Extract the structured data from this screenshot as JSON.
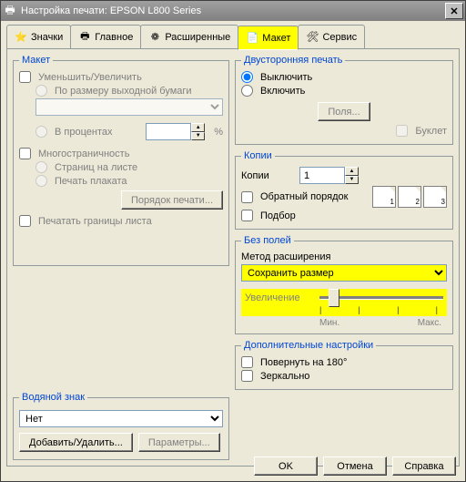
{
  "title": "Настройка печати: EPSON L800 Series",
  "tabs": {
    "icons": "Значки",
    "main": "Главное",
    "ext": "Расширенные",
    "layout": "Макет",
    "service": "Сервис"
  },
  "layout": {
    "group": "Макет",
    "reduce": "Уменьшить/Увеличить",
    "fit": "По размеру выходной бумаги",
    "percent": "В процентах",
    "percent_sign": "%",
    "multi": "Многостраничность",
    "pages_sheet": "Страниц на листе",
    "poster": "Печать плаката",
    "order_btn": "Порядок печати...",
    "borders": "Печатать границы листа"
  },
  "watermark": {
    "group": "Водяной знак",
    "none": "Нет",
    "add": "Добавить/Удалить...",
    "params": "Параметры..."
  },
  "duplex": {
    "group": "Двусторонняя печать",
    "off": "Выключить",
    "on": "Включить",
    "margins_btn": "Поля...",
    "booklet": "Буклет"
  },
  "copies": {
    "group": "Копии",
    "label": "Копии",
    "value": "1",
    "reverse": "Обратный порядок",
    "collate": "Подбор"
  },
  "borderless": {
    "group": "Без полей",
    "method": "Метод расширения",
    "selected": "Сохранить размер",
    "enlarge": "Увеличение",
    "min": "Мин.",
    "max": "Макс."
  },
  "more": {
    "group": "Дополнительные настройки",
    "rotate": "Повернуть на 180°",
    "mirror": "Зеркально"
  },
  "buttons": {
    "ok": "OK",
    "cancel": "Отмена",
    "help": "Справка"
  }
}
